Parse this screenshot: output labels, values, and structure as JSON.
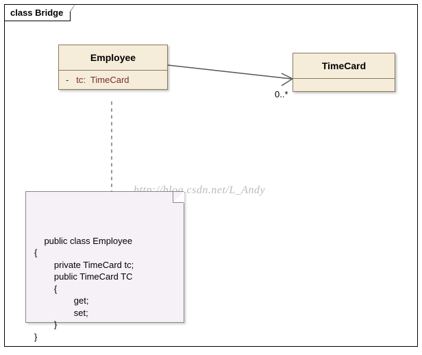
{
  "frame": {
    "title": "class Bridge"
  },
  "employee": {
    "name": "Employee",
    "attr_vis": "-",
    "attr_name": "tc:",
    "attr_type": "TimeCard"
  },
  "timecard": {
    "name": "TimeCard"
  },
  "multiplicity": "0..*",
  "note_code": "public class Employee\n{\n        private TimeCard tc;\n        public TimeCard TC\n        {\n                get;\n                set;\n        }\n}",
  "watermark": "http://blog.csdn.net/L_Andy",
  "chart_data": {
    "type": "table",
    "diagram_kind": "uml_class_diagram",
    "frame_name": "Bridge",
    "classes": [
      {
        "name": "Employee",
        "attributes": [
          {
            "visibility": "-",
            "name": "tc",
            "type": "TimeCard"
          }
        ],
        "note": "public class Employee\n{\n    private TimeCard tc;\n    public TimeCard TC\n    {\n        get;\n        set;\n    }\n}"
      },
      {
        "name": "TimeCard",
        "attributes": []
      }
    ],
    "associations": [
      {
        "from": "Employee",
        "to": "TimeCard",
        "navigability": "to",
        "multiplicity_to": "0..*"
      }
    ]
  }
}
